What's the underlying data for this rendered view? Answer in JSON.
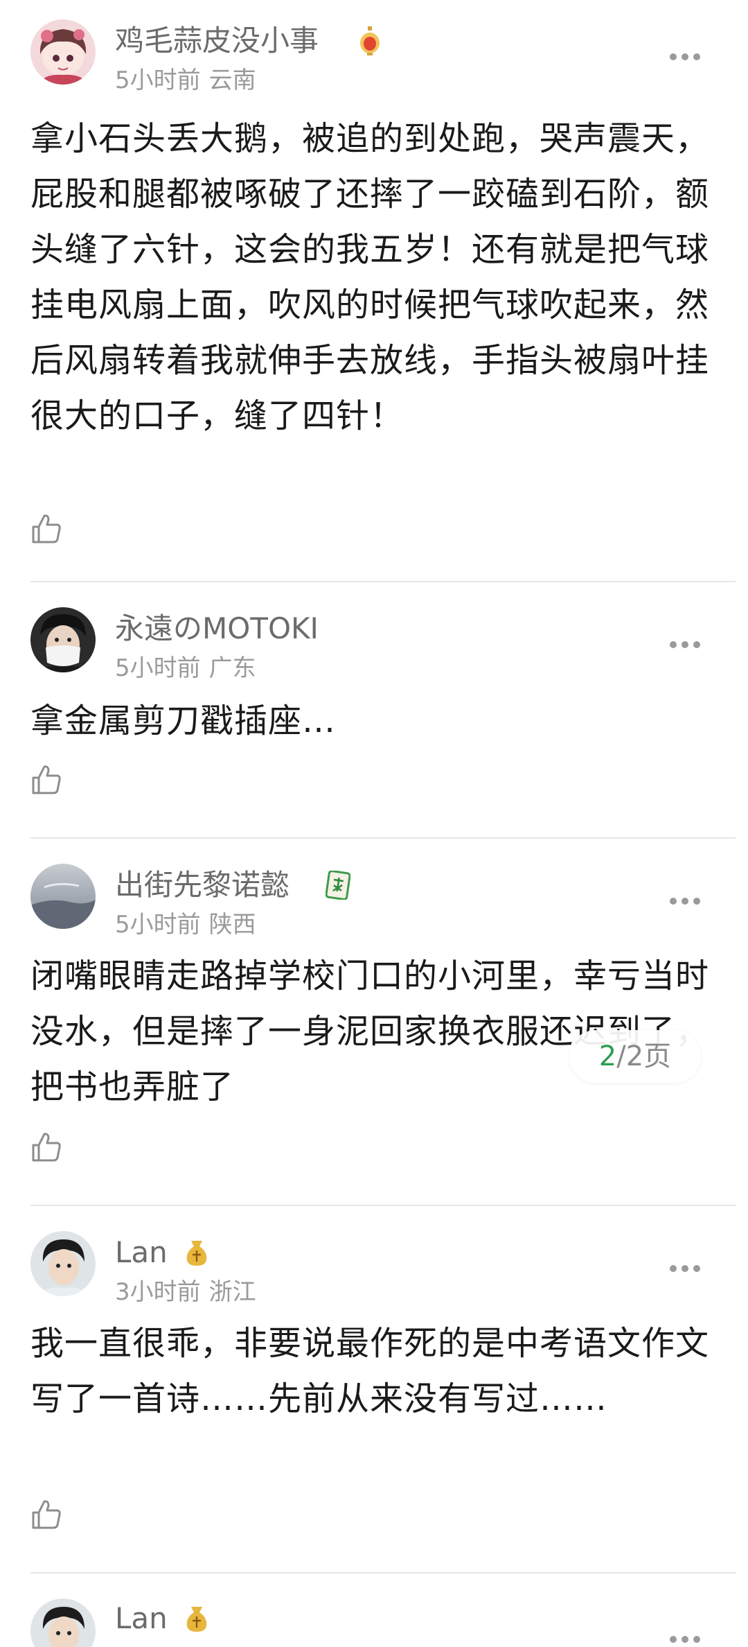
{
  "comments": [
    {
      "username": "鸡毛蒜皮没小事",
      "time": "5小时前",
      "location": "云南",
      "text": "拿小石头丢大鹅，被追的到处跑，哭声震天，屁股和腿都被啄破了还摔了一跤磕到石阶，额头缝了六针，这会的我五岁！还有就是把气球挂电风扇上面，吹风的时候把气球吹起来，然后风扇转着我就伸手去放线，手指头被扇叶挂很大的口子，缝了四针！",
      "badge": "lantern-badge-icon"
    },
    {
      "username": "永遠のMOTOKI",
      "time": "5小时前",
      "location": "广东",
      "text": "拿金属剪刀戳插座…"
    },
    {
      "username": "出街先黎诺懿",
      "time": "5小时前",
      "location": "陕西",
      "text": "闭嘴眼睛走路掉学校门口的小河里，幸亏当时没水，但是摔了一身泥回家换衣服还迟到了，把书也弄脏了",
      "badge": "mahjong-fa-badge-icon"
    },
    {
      "username": "Lan",
      "time": "3小时前",
      "location": "浙江",
      "text": "我一直很乖，非要说最作死的是中考语文作文写了一首诗……先前从来没有写过……",
      "badge": "gold-bag-badge-icon"
    },
    {
      "username": "Lan",
      "badge": "gold-bag-badge-icon"
    }
  ],
  "pagination": {
    "current": "2",
    "separator": "/",
    "total_label": "2页"
  },
  "colors": {
    "username": "#6b6b6b",
    "meta": "#9a9a9a",
    "body_text": "#1a1a1a",
    "divider": "#e6e6e6",
    "page_current": "#2e9e52",
    "page_text": "#8a8a8a",
    "icon_gray": "#8c8c8c"
  },
  "icons": {
    "more": "more-dots-icon",
    "like": "thumbs-up-icon"
  }
}
